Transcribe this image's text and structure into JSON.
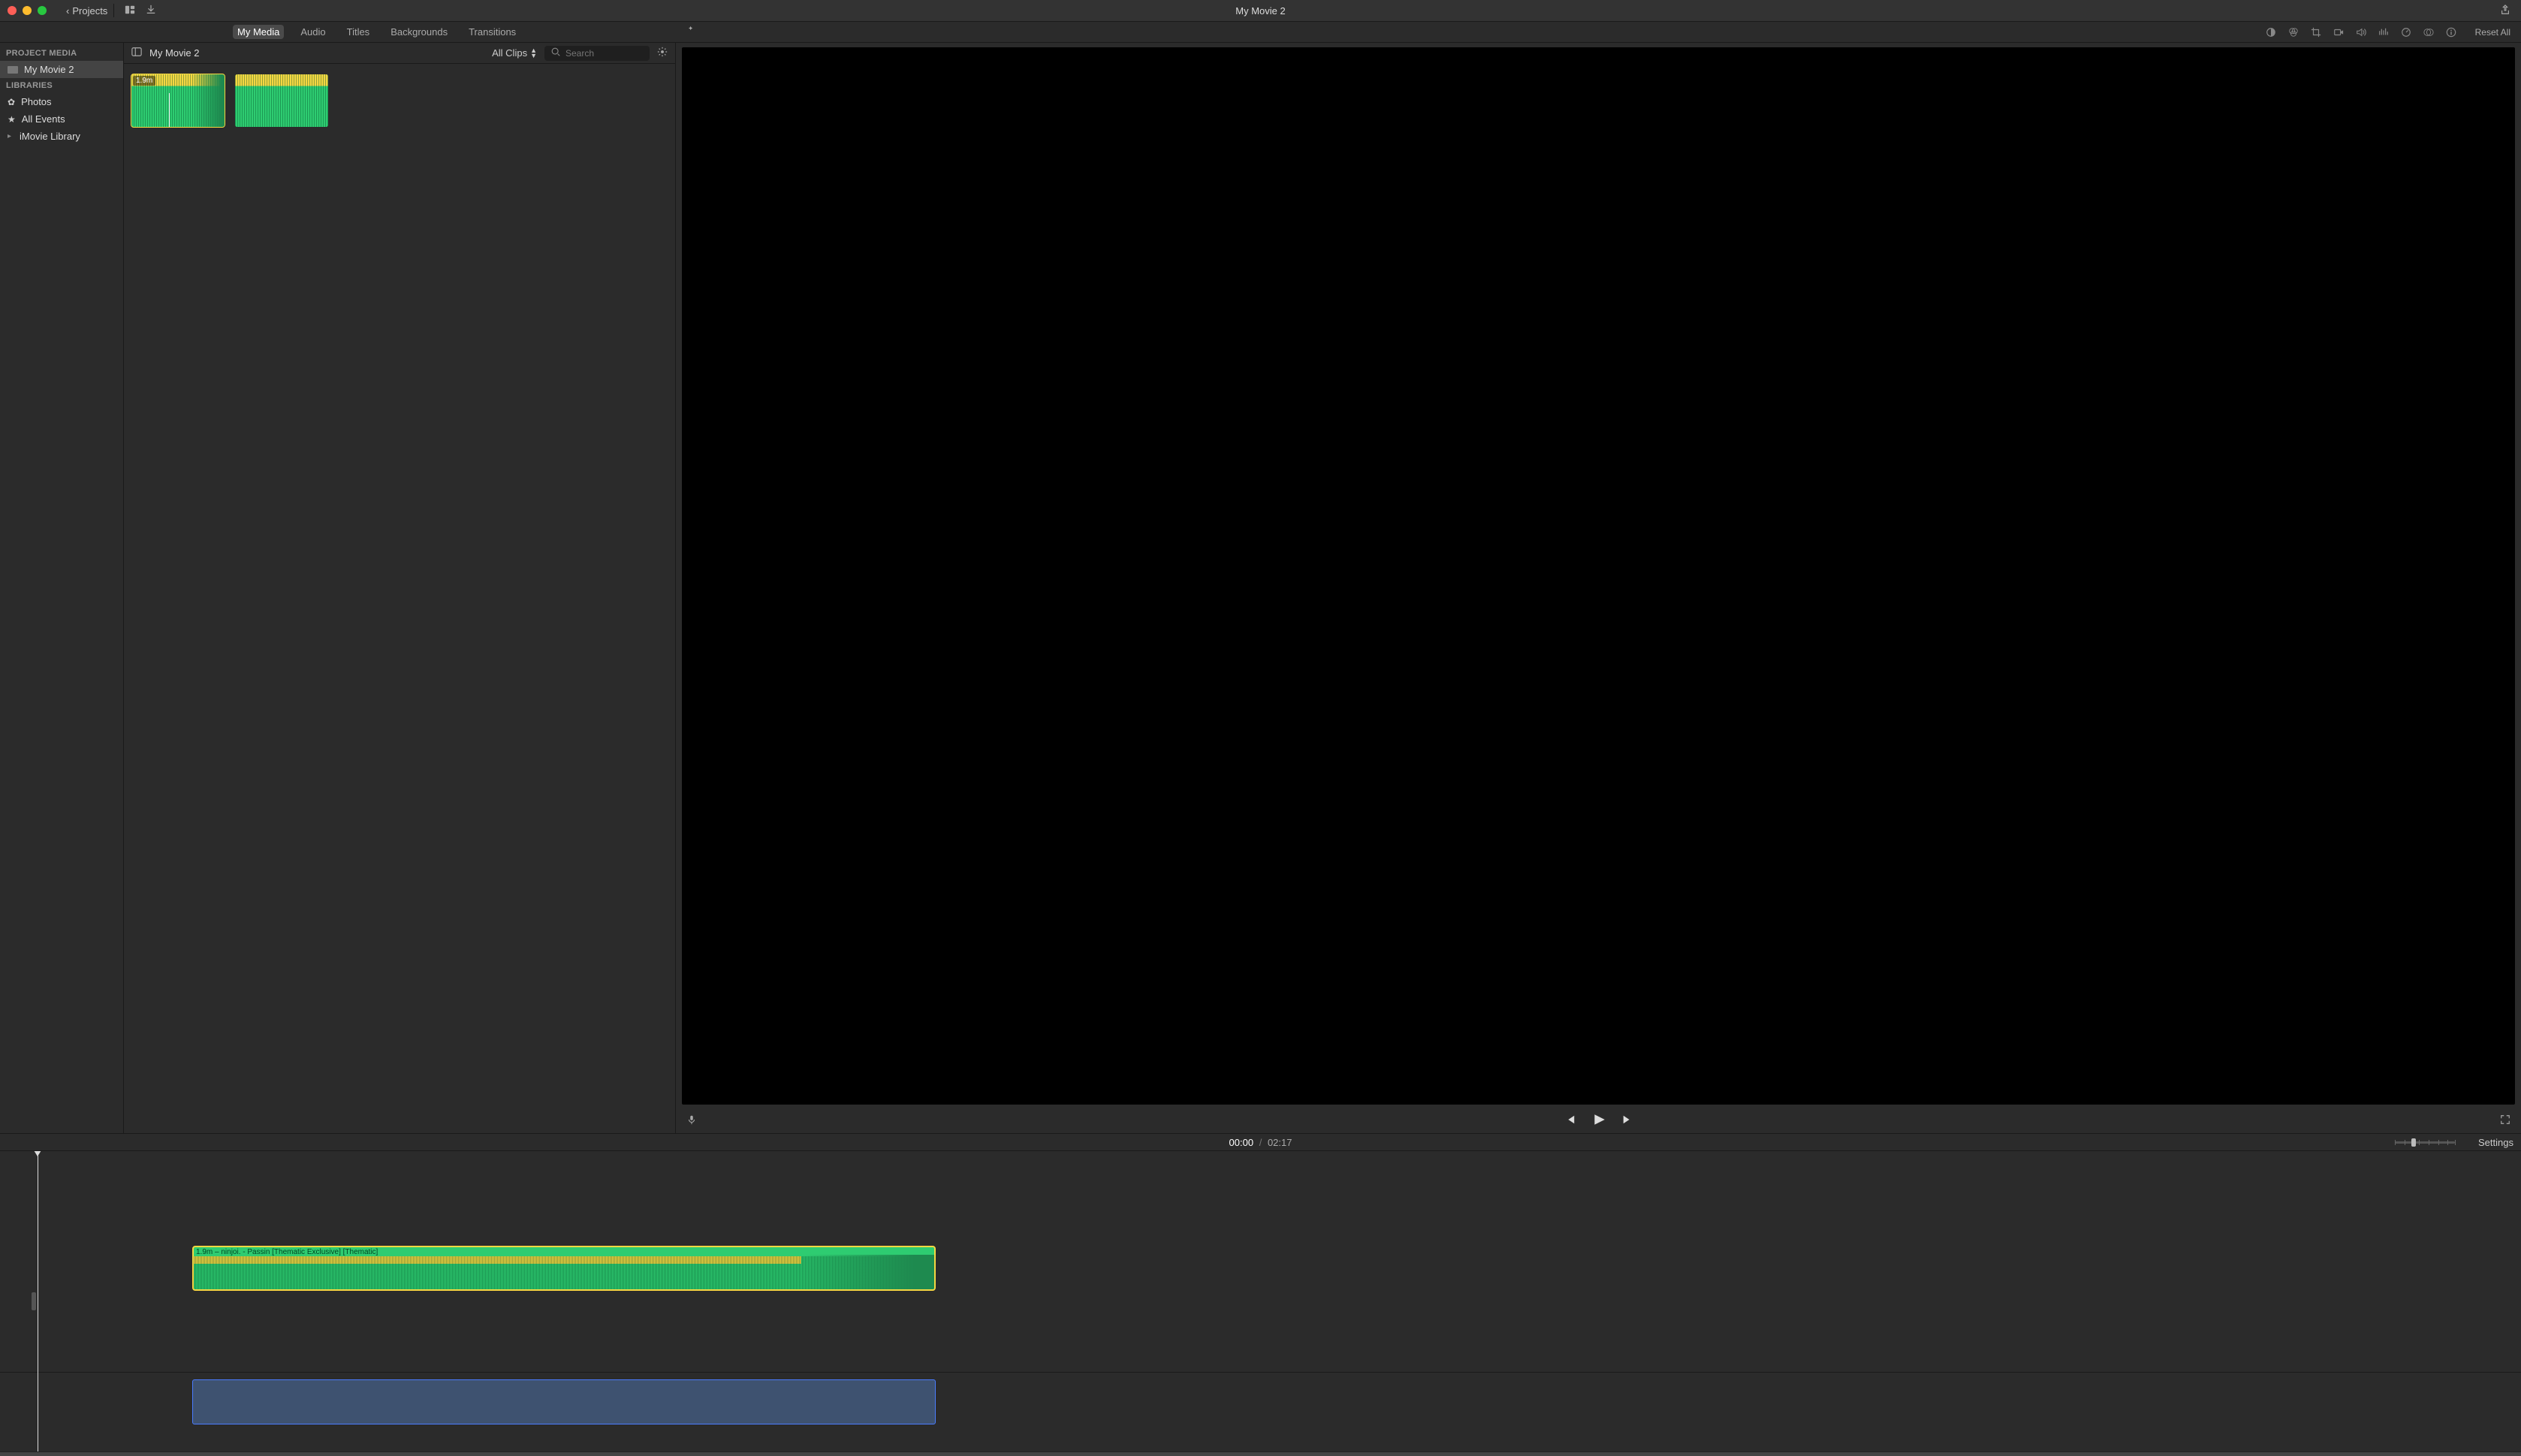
{
  "titlebar": {
    "projects_label": "Projects",
    "title": "My Movie 2"
  },
  "tabs": {
    "my_media": "My Media",
    "audio": "Audio",
    "titles": "Titles",
    "backgrounds": "Backgrounds",
    "transitions": "Transitions",
    "reset_all": "Reset All"
  },
  "sidebar": {
    "project_media_hdr": "PROJECT MEDIA",
    "project_item": "My Movie 2",
    "libraries_hdr": "LIBRARIES",
    "photos": "Photos",
    "all_events": "All Events",
    "imovie_library": "iMovie Library"
  },
  "browser": {
    "title": "My Movie 2",
    "filter_label": "All Clips",
    "search_placeholder": "Search",
    "clip1_badge": "1.9m"
  },
  "timeline_header": {
    "current": "00:00",
    "separator": "/",
    "total": "02:17",
    "settings": "Settings"
  },
  "timeline": {
    "clip_label": "1.9m – ninjoi. - Passin [Thematic Exclusive] [Thematic]"
  }
}
